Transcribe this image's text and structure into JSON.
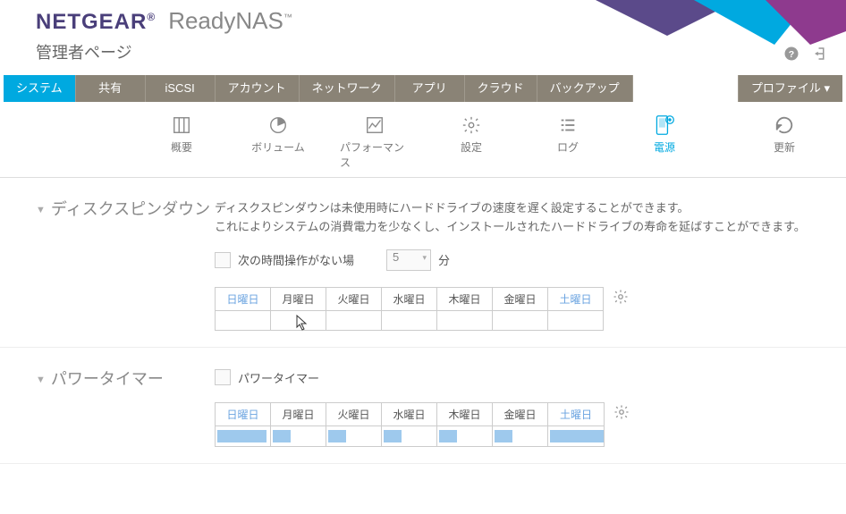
{
  "brand": {
    "name": "NETGEAR",
    "product": "ReadyNAS"
  },
  "pageTitle": "管理者ページ",
  "nav": {
    "items": [
      "システム",
      "共有",
      "iSCSI",
      "アカウント",
      "ネットワーク",
      "アプリ",
      "クラウド",
      "バックアップ"
    ],
    "right": "プロファイル ▾",
    "activeIndex": 0
  },
  "subnav": {
    "items": [
      {
        "label": "概要",
        "icon": "overview"
      },
      {
        "label": "ボリューム",
        "icon": "volume"
      },
      {
        "label": "パフォーマンス",
        "icon": "perf"
      },
      {
        "label": "設定",
        "icon": "gear"
      },
      {
        "label": "ログ",
        "icon": "log"
      },
      {
        "label": "電源",
        "icon": "power"
      }
    ],
    "activeIndex": 5,
    "refresh": "更新"
  },
  "spindown": {
    "title": "ディスクスピンダウン",
    "desc1": "ディスクスピンダウンは未使用時にハードドライブの速度を遅く設定することができます。",
    "desc2": "これによりシステムの消費電力を少なくし、インストールされたハードドライブの寿命を延ばすことができます。",
    "checkboxLabel": "次の時間操作がない場",
    "minutesValue": "5",
    "minutesUnit": "分",
    "days": [
      "日曜日",
      "月曜日",
      "火曜日",
      "水曜日",
      "木曜日",
      "金曜日",
      "土曜日"
    ]
  },
  "powertimer": {
    "title": "パワータイマー",
    "checkboxLabel": "パワータイマー",
    "days": [
      "日曜日",
      "月曜日",
      "火曜日",
      "水曜日",
      "木曜日",
      "金曜日",
      "土曜日"
    ],
    "bars": [
      55,
      20,
      20,
      20,
      20,
      20,
      60
    ]
  }
}
